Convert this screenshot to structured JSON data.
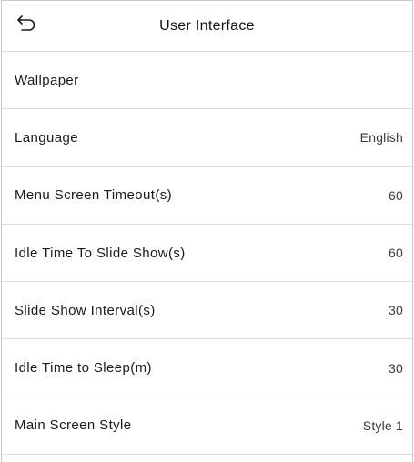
{
  "header": {
    "back_icon": "back-arrow-icon",
    "title": "User Interface"
  },
  "menu": {
    "items": [
      {
        "label": "Wallpaper",
        "value": ""
      },
      {
        "label": "Language",
        "value": "English"
      },
      {
        "label": "Menu Screen Timeout(s)",
        "value": "60"
      },
      {
        "label": "Idle Time To Slide Show(s)",
        "value": "60"
      },
      {
        "label": "Slide Show Interval(s)",
        "value": "30"
      },
      {
        "label": "Idle Time to Sleep(m)",
        "value": "30"
      },
      {
        "label": "Main Screen Style",
        "value": "Style 1"
      }
    ]
  }
}
